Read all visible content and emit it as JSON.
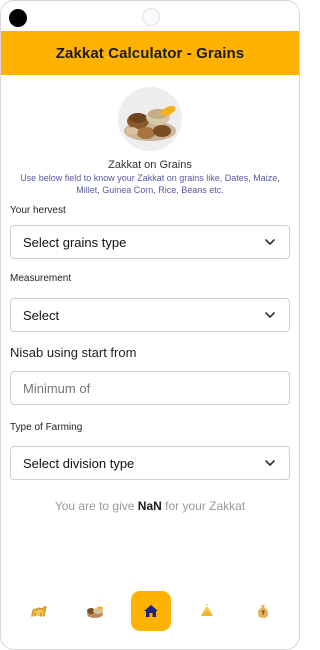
{
  "app": {
    "title": "Zakkat Calculator - Grains"
  },
  "intro": {
    "title": "Zakkat on Grains",
    "description": "Use below field to know your Zakkat on grains like, Dates, Maize, Millet, Guinea Corn, Rice, Beans etc."
  },
  "form": {
    "harvest_label": "Your hervest",
    "harvest_value": "Select grains type",
    "measurement_label": "Measurement",
    "measurement_value": "Select",
    "nisab_label": "Nisab using start from",
    "nisab_placeholder": "Minimum of",
    "farming_label": "Type of Farming",
    "farming_value": "Select division type"
  },
  "result": {
    "prefix": "You are to give",
    "amount": "NaN",
    "suffix": "for your Zakkat"
  },
  "nav": {
    "items": [
      {
        "icon": "camel-icon"
      },
      {
        "icon": "grains-icon"
      },
      {
        "icon": "home-icon",
        "active": true
      },
      {
        "icon": "gold-icon"
      },
      {
        "icon": "money-bag-icon"
      }
    ]
  },
  "colors": {
    "accent": "#ffb300",
    "active_icon": "#1a237e"
  }
}
